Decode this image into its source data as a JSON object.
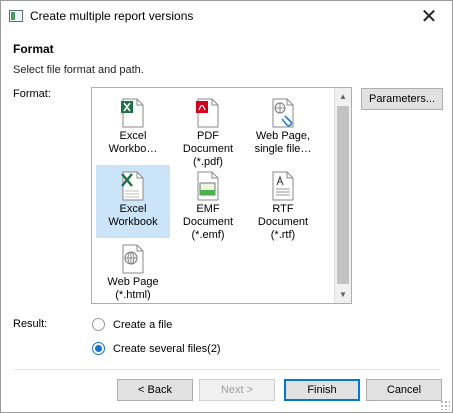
{
  "window": {
    "title": "Create multiple report versions",
    "close_glyph": "✕"
  },
  "section": {
    "title": "Format",
    "description": "Select file format and path."
  },
  "format": {
    "label": "Format:",
    "tiles": [
      {
        "line1": "Excel",
        "line2": "Workbo…",
        "icon": "excel-97-icon",
        "selected": false
      },
      {
        "line1": "PDF Document",
        "line2": "(*.pdf)",
        "icon": "pdf-icon",
        "selected": false
      },
      {
        "line1": "Web Page,",
        "line2": "single file…",
        "icon": "web-archive-icon",
        "selected": false
      },
      {
        "line1": "Excel",
        "line2": "Workbook",
        "icon": "excel-icon",
        "selected": true
      },
      {
        "line1": "EMF Document",
        "line2": "(*.emf)",
        "icon": "emf-icon",
        "selected": false
      },
      {
        "line1": "RTF Document",
        "line2": "(*.rtf)",
        "icon": "rtf-icon",
        "selected": false
      },
      {
        "line1": "Web Page",
        "line2": "(*.html)",
        "icon": "html-icon",
        "selected": false
      }
    ],
    "parameters_label": "Parameters..."
  },
  "result": {
    "label": "Result:",
    "options": [
      {
        "label": "Create a file",
        "checked": false
      },
      {
        "label": "Create several files(2)",
        "checked": true
      }
    ]
  },
  "footer": {
    "back_label": "< Back",
    "next_label": "Next >",
    "finish_label": "Finish",
    "cancel_label": "Cancel"
  },
  "colors": {
    "accent": "#0078d7",
    "selection": "#cce4f7",
    "excel_green": "#1e7145",
    "pdf_red": "#d0021b"
  }
}
